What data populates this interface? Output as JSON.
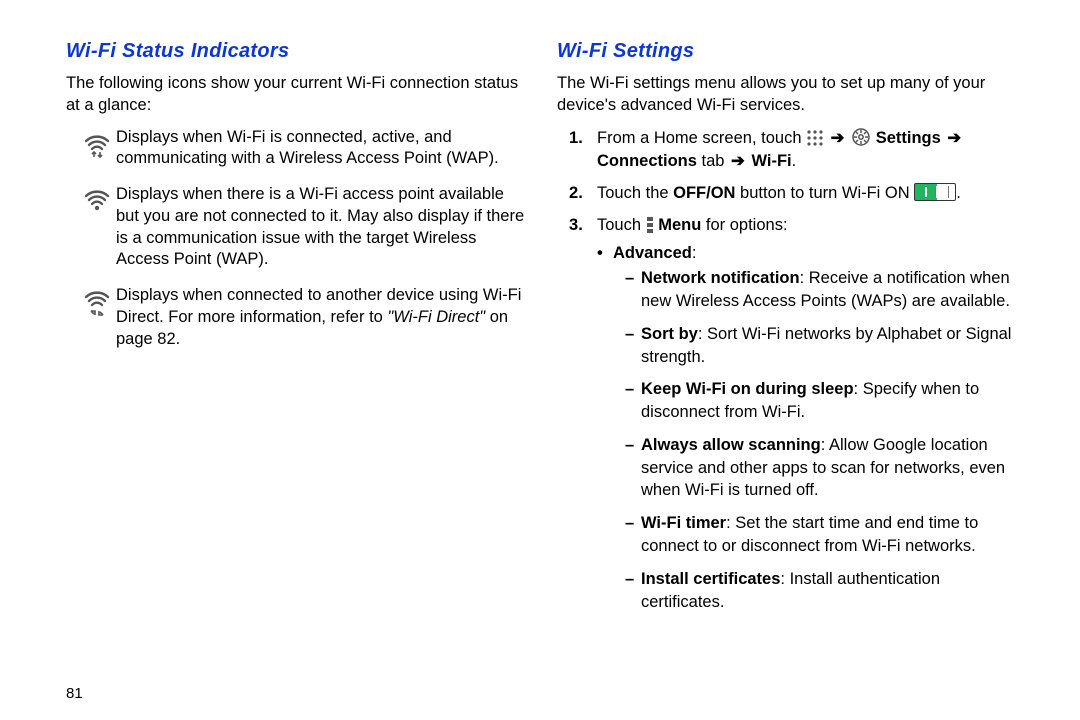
{
  "page_number": "81",
  "left": {
    "heading": "Wi-Fi Status Indicators",
    "intro": "The following icons show your current Wi-Fi connection status at a glance:",
    "rows": [
      {
        "icon": "wifi-active-icon",
        "text": "Displays when Wi-Fi is connected, active, and communicating with a Wireless Access Point (WAP)."
      },
      {
        "icon": "wifi-available-icon",
        "text": "Displays when there is a Wi-Fi access point available but you are not connected to it. May also display if there is a communication issue with the target Wireless Access Point (WAP)."
      },
      {
        "icon": "wifi-direct-icon",
        "text_prefix": "Displays when connected to another device using Wi-Fi Direct. For more information, refer to ",
        "ref": "\"Wi-Fi Direct\"",
        "text_suffix": " on page 82."
      }
    ]
  },
  "right": {
    "heading": "Wi-Fi Settings",
    "intro": "The Wi-Fi settings menu allows you to set up many of your device's advanced Wi-Fi services.",
    "step1": {
      "prefix": "From a Home screen, touch ",
      "arrow": "➔",
      "settings": "Settings",
      "connections": "Connections",
      "tab_word": " tab ",
      "wifi": "Wi-Fi",
      "period": "."
    },
    "step2": {
      "prefix": "Touch the ",
      "offon": "OFF/ON",
      "mid": " button to turn Wi-Fi ON ",
      "period": "."
    },
    "step3": {
      "prefix": "Touch ",
      "menu": "Menu",
      "suffix": " for options:",
      "advanced_label": "Advanced",
      "advanced_colon": ":",
      "items": [
        {
          "label": "Network notification",
          "text": ": Receive a notification when new Wireless Access Points (WAPs) are available."
        },
        {
          "label": "Sort by",
          "text": ": Sort Wi-Fi networks by Alphabet or Signal strength."
        },
        {
          "label": "Keep Wi-Fi on during sleep",
          "text": ": Specify when to disconnect from Wi-Fi."
        },
        {
          "label": "Always allow scanning",
          "text": ": Allow Google location service and other apps to scan for networks, even when Wi-Fi is turned off."
        },
        {
          "label": "Wi-Fi timer",
          "text": ": Set the start time and end time to connect to or disconnect from Wi-Fi networks."
        },
        {
          "label": "Install certificates",
          "text": ": Install authentication certificates."
        }
      ]
    }
  }
}
